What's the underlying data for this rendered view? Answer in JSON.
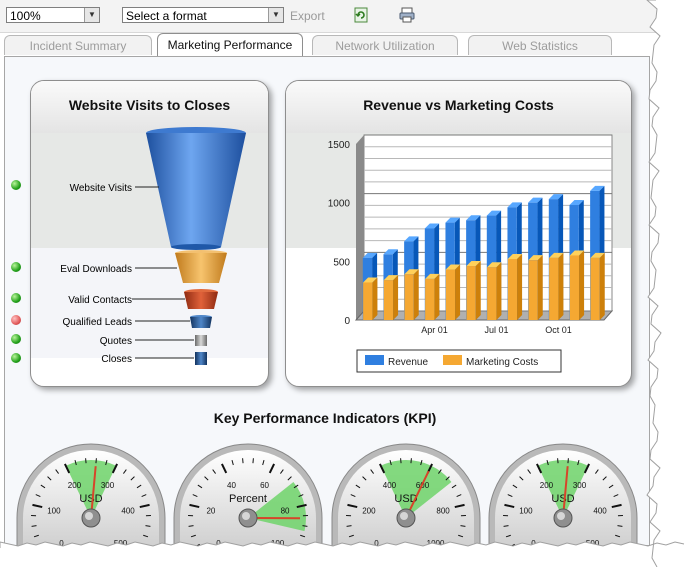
{
  "toolbar": {
    "zoom_value": "100%",
    "format_value": "Select a format",
    "export_label": "Export",
    "refresh_icon": "refresh-icon",
    "print_icon": "printer-icon"
  },
  "tabs": [
    {
      "label": "Incident Summary",
      "active": false
    },
    {
      "label": "Marketing Performance",
      "active": true
    },
    {
      "label": "Network Utilization",
      "active": false
    },
    {
      "label": "Web Statistics",
      "active": false
    }
  ],
  "funnel": {
    "title": "Website Visits to Closes",
    "stages": [
      {
        "label": "Website Visits",
        "status": "green"
      },
      {
        "label": "Eval Downloads",
        "status": "green"
      },
      {
        "label": "Valid Contacts",
        "status": "green"
      },
      {
        "label": "Qualified Leads",
        "status": "red"
      },
      {
        "label": "Quotes",
        "status": "green"
      },
      {
        "label": "Closes",
        "status": "green"
      }
    ]
  },
  "revenue_chart": {
    "title": "Revenue vs Marketing Costs",
    "legend": [
      "Revenue",
      "Marketing Costs"
    ],
    "colors": {
      "revenue": "#2f7fe0",
      "costs": "#f5a832"
    }
  },
  "chart_data": {
    "type": "bar",
    "title": "Revenue vs Marketing Costs",
    "categories": [
      "",
      "",
      "",
      "Apr 01",
      "",
      "",
      "Jul 01",
      "",
      "",
      "Oct 01",
      "",
      ""
    ],
    "series": [
      {
        "name": "Revenue",
        "values": [
          530,
          560,
          670,
          780,
          830,
          850,
          890,
          960,
          1000,
          1030,
          980,
          1100
        ]
      },
      {
        "name": "Marketing Costs",
        "values": [
          320,
          340,
          390,
          350,
          430,
          460,
          450,
          520,
          510,
          530,
          550,
          530
        ]
      }
    ],
    "ylim": [
      0,
      1500
    ],
    "yticks": [
      0,
      500,
      1000,
      1500
    ],
    "grid": true,
    "legend_position": "bottom"
  },
  "kpi": {
    "title": "Key Performance Indicators (KPI)",
    "gauges": [
      {
        "label": "USD",
        "ticks": [
          "0",
          "100",
          "200",
          "300",
          "400",
          "500"
        ],
        "min": 0,
        "max": 500,
        "value": 260,
        "band": [
          200,
          300
        ]
      },
      {
        "label": "Percent",
        "ticks": [
          "0",
          "20",
          "40",
          "60",
          "80",
          "100"
        ],
        "min": 0,
        "max": 100,
        "value": 85,
        "band": [
          70,
          90
        ]
      },
      {
        "label": "USD",
        "ticks": [
          "0",
          "200",
          "400",
          "600",
          "800",
          "1000"
        ],
        "min": 0,
        "max": 1000,
        "value": 600,
        "band": [
          400,
          700
        ]
      },
      {
        "label": "USD",
        "ticks": [
          "0",
          "100",
          "200",
          "300",
          "400",
          "500"
        ],
        "min": 0,
        "max": 500,
        "value": 260,
        "band": [
          200,
          300
        ]
      }
    ]
  }
}
